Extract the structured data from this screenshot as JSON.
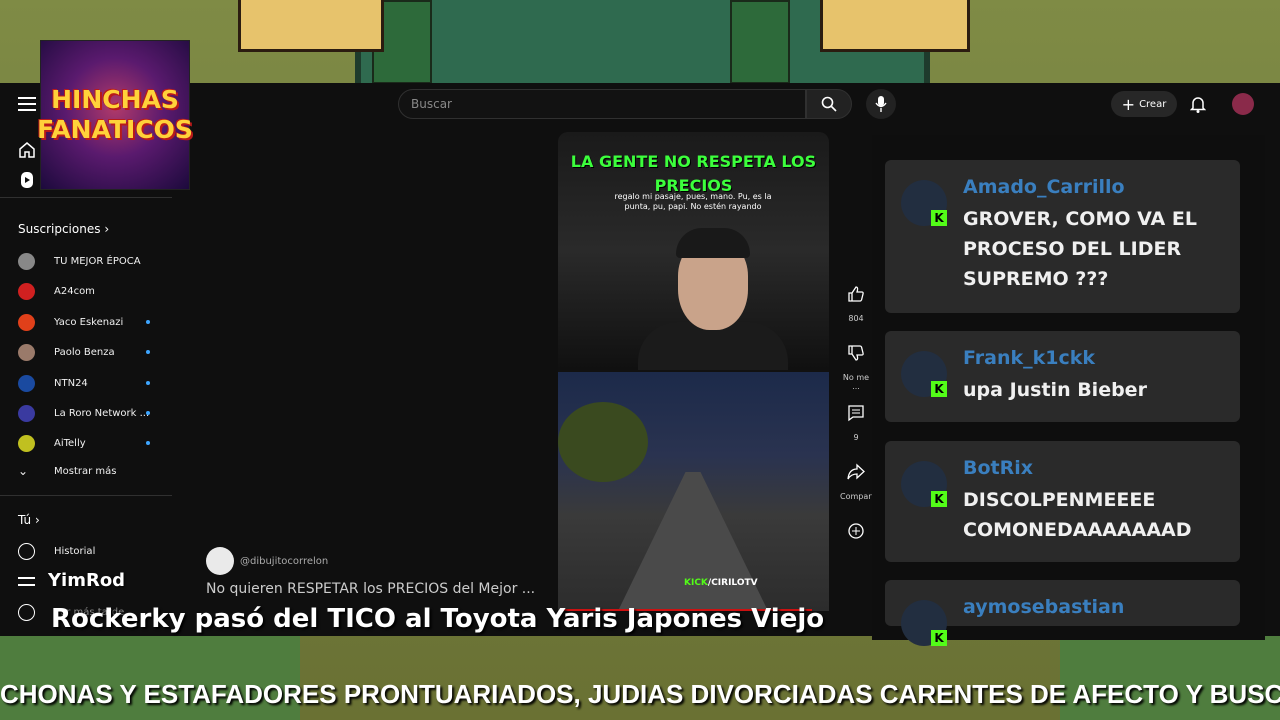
{
  "overlay": {
    "logo_line1": "HINCHAS",
    "logo_line2": "FANATICOS",
    "streamer_name": "YimRod",
    "stream_title": "Rockerky pasó del TICO al Toyota Yaris Japones Viejo",
    "ticker": "CHONAS Y ESTAFADORES PRONTUARIADOS, JUDIAS DIVORCIADAS CARENTES DE AFECTO Y BUSCADORAS DE RECONOCIM"
  },
  "header": {
    "search_placeholder": "Buscar",
    "create_label": "Crear"
  },
  "sidebar": {
    "subscriptions_label": "Suscripciones",
    "subscriptions": [
      {
        "name": "TU MEJOR ÉPOCA",
        "color": "#888888"
      },
      {
        "name": "A24com",
        "color": "#d02020"
      },
      {
        "name": "Yaco Eskenazi",
        "color": "#e0401a"
      },
      {
        "name": "Paolo Benza",
        "color": "#9a7a6a"
      },
      {
        "name": "NTN24",
        "color": "#1a4aa0"
      },
      {
        "name": "La Roro Network ...",
        "color": "#3a3aa0"
      },
      {
        "name": "AiTelly",
        "color": "#c0c020"
      }
    ],
    "show_more_label": "Mostrar más",
    "you_label": "Tú",
    "history_label": "Historial",
    "watch_later_label": "Ver más tarde"
  },
  "video": {
    "caption_main": "LA GENTE NO RESPETA LOS PRECIOS",
    "caption_sub": "regalo mi pasaje, pues, mano. Pu, es la punta, pu, papi. No estén rayando",
    "watermark_prefix": "KICK",
    "watermark_suffix": "/CIRILOTV",
    "channel_handle": "@dibujitocorrelon",
    "title": "No quieren RESPETAR los PRECIOS del Mejor ..."
  },
  "actions": {
    "like_count": "804",
    "dislike_label": "No me ...",
    "comment_count": "9",
    "share_label": "Compartir"
  },
  "chat": {
    "messages": [
      {
        "user": "Amado_Carrillo",
        "text": "GROVER, COMO VA EL PROCESO DEL LIDER SUPREMO ???"
      },
      {
        "user": "Frank_k1ckk",
        "text": "upa Justin Bieber"
      },
      {
        "user": "BotRix",
        "text": "DISCOLPENMEEEE COMONEDAAAAAAAD"
      },
      {
        "user": "aymosebastian",
        "text": ""
      }
    ],
    "badge_letter": "K"
  },
  "colors": {
    "chat_username": "#3a7fbf",
    "kick_green": "#53fc18",
    "caption_green": "#3cff3c"
  }
}
